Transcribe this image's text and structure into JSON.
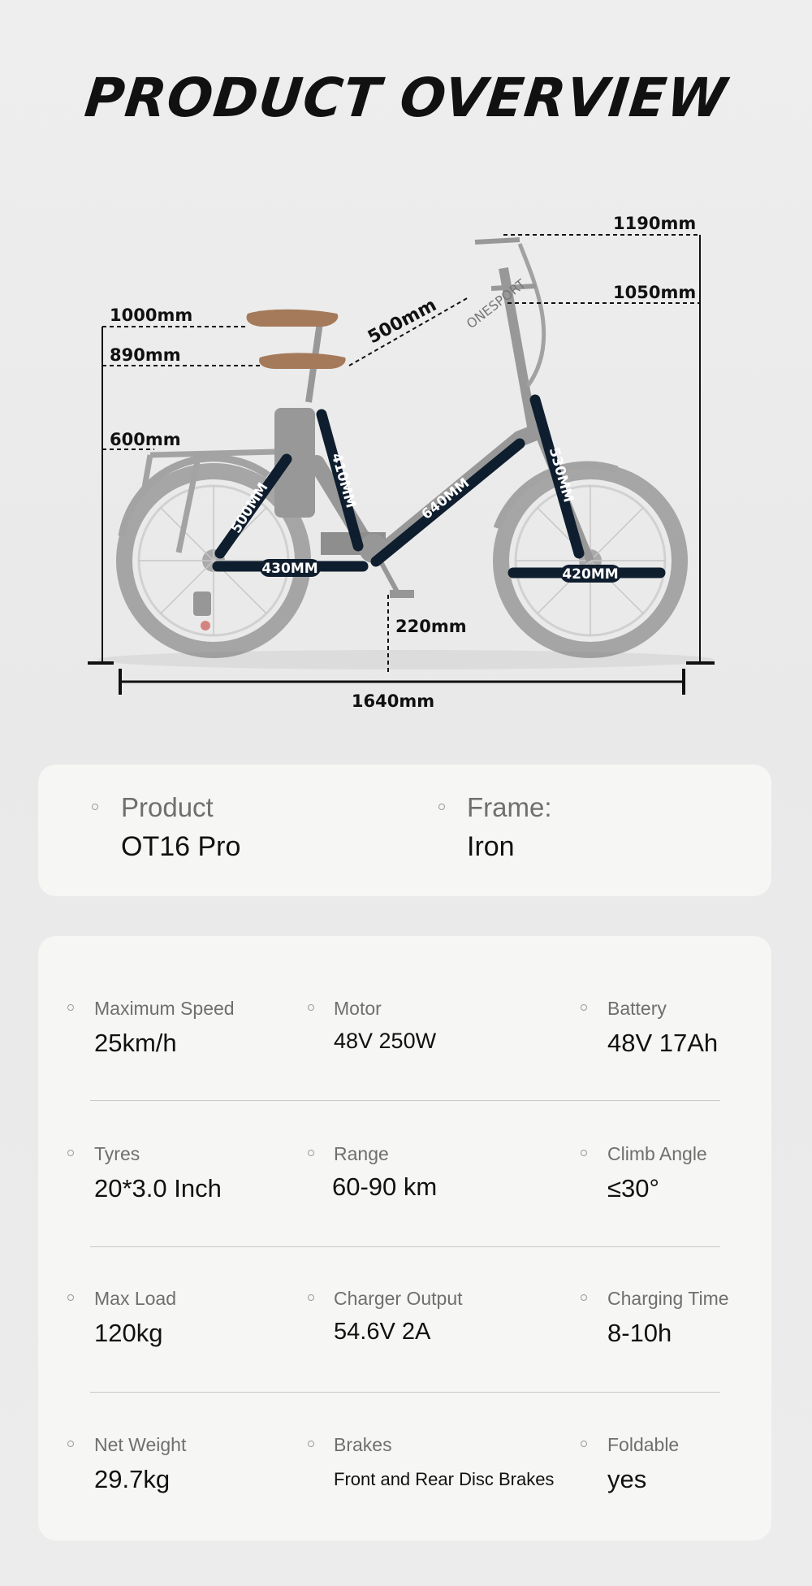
{
  "title": "PRODUCT OVERVIEW",
  "diagram": {
    "dimensions": {
      "handlebar_top": "1190mm",
      "handlebar_low": "1050mm",
      "seat_high": "1000mm",
      "seat_low": "890mm",
      "rack_height": "600mm",
      "reach": "500mm",
      "pedal_ground": "220mm",
      "wheelbase_length": "1640mm"
    },
    "frame_labels": {
      "seat_stay": "500MM",
      "seat_tube": "410MM",
      "chain_stay": "430MM",
      "down_tube": "640MM",
      "head_tube": "530MM",
      "fork": "420MM"
    },
    "brand_mark": "ONESPORT"
  },
  "product_card": {
    "product_label": "Product",
    "product_value": "OT16 Pro",
    "frame_label": "Frame:",
    "frame_value": "Iron"
  },
  "specs": [
    {
      "label": "Maximum Speed",
      "value": "25km/h"
    },
    {
      "label": "Motor",
      "value": "48V 250W"
    },
    {
      "label": "Battery",
      "value": "48V 17Ah"
    },
    {
      "label": "Tyres",
      "value": "20*3.0 Inch"
    },
    {
      "label": "Range",
      "value": "60-90 km"
    },
    {
      "label": "Climb Angle",
      "value": "≤30°"
    },
    {
      "label": "Max Load",
      "value": "120kg"
    },
    {
      "label": "Charger Output",
      "value": "54.6V 2A"
    },
    {
      "label": "Charging Time",
      "value": "8-10h"
    },
    {
      "label": "Net Weight",
      "value": "29.7kg"
    },
    {
      "label": "Brakes",
      "value": "Front and Rear Disc Brakes"
    },
    {
      "label": "Foldable",
      "value": "yes"
    }
  ],
  "colors": {
    "frame_bar": "#0f1e2e",
    "bike_gray": "#8a8a8a",
    "saddle": "#a57a5a"
  }
}
